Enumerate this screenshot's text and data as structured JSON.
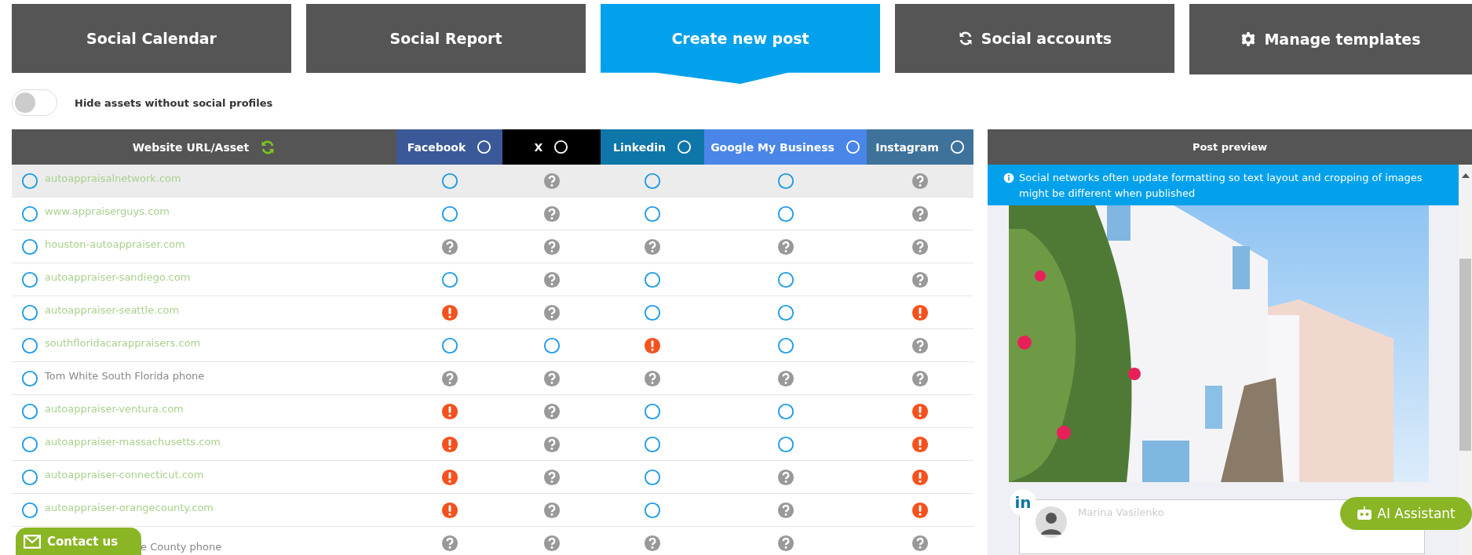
{
  "tabs": [
    {
      "label": "Social Calendar",
      "kind": "plain",
      "selected": false
    },
    {
      "label": "Social Report",
      "kind": "plain",
      "selected": false
    },
    {
      "label": "Create new post",
      "kind": "plain",
      "selected": true
    },
    {
      "label": "Social accounts",
      "kind": "refresh",
      "selected": false
    },
    {
      "label": "Manage templates",
      "kind": "gear",
      "selected": false
    }
  ],
  "filter_toggle": {
    "label": "Hide assets without social profiles",
    "on": false
  },
  "table": {
    "asset_column": "Website URL/Asset",
    "networks": [
      {
        "label": "Facebook",
        "color": "#3b5998"
      },
      {
        "label": "X",
        "color": "#000000"
      },
      {
        "label": "Linkedin",
        "color": "#0e76a8"
      },
      {
        "label": "Google My Business",
        "color": "#4a86e8"
      },
      {
        "label": "Instagram",
        "color": "#3f729b"
      }
    ],
    "rows": [
      {
        "asset": "autoappraisalnetwork.com",
        "kind": "url",
        "selected": true,
        "cells": [
          {
            "kind": "open"
          },
          {
            "kind": "unknown"
          },
          {
            "kind": "open"
          },
          {
            "kind": "open"
          },
          {
            "kind": "unknown"
          }
        ]
      },
      {
        "asset": "www.appraiserguys.com",
        "kind": "url",
        "selected": false,
        "cells": [
          {
            "kind": "open"
          },
          {
            "kind": "unknown"
          },
          {
            "kind": "open"
          },
          {
            "kind": "open"
          },
          {
            "kind": "unknown"
          }
        ]
      },
      {
        "asset": "houston-autoappraiser.com",
        "kind": "url",
        "selected": false,
        "cells": [
          {
            "kind": "unknown"
          },
          {
            "kind": "unknown"
          },
          {
            "kind": "unknown"
          },
          {
            "kind": "unknown"
          },
          {
            "kind": "unknown"
          }
        ]
      },
      {
        "asset": "autoappraiser-sandiego.com",
        "kind": "url",
        "selected": false,
        "cells": [
          {
            "kind": "open"
          },
          {
            "kind": "unknown"
          },
          {
            "kind": "open"
          },
          {
            "kind": "open"
          },
          {
            "kind": "unknown"
          }
        ]
      },
      {
        "asset": "autoappraiser-seattle.com",
        "kind": "url",
        "selected": false,
        "cells": [
          {
            "kind": "error"
          },
          {
            "kind": "unknown"
          },
          {
            "kind": "open"
          },
          {
            "kind": "open"
          },
          {
            "kind": "error"
          }
        ]
      },
      {
        "asset": "southfloridacarappraisers.com",
        "kind": "url",
        "selected": false,
        "cells": [
          {
            "kind": "open"
          },
          {
            "kind": "open"
          },
          {
            "kind": "error"
          },
          {
            "kind": "open"
          },
          {
            "kind": "unknown"
          }
        ]
      },
      {
        "asset": "Tom White South Florida phone",
        "kind": "phone",
        "selected": false,
        "cells": [
          {
            "kind": "unknown"
          },
          {
            "kind": "unknown"
          },
          {
            "kind": "unknown"
          },
          {
            "kind": "unknown"
          },
          {
            "kind": "unknown"
          }
        ]
      },
      {
        "asset": "autoappraiser-ventura.com",
        "kind": "url",
        "selected": false,
        "cells": [
          {
            "kind": "error"
          },
          {
            "kind": "unknown"
          },
          {
            "kind": "open"
          },
          {
            "kind": "open"
          },
          {
            "kind": "error"
          }
        ]
      },
      {
        "asset": "autoappraiser-massachusetts.com",
        "kind": "url",
        "selected": false,
        "cells": [
          {
            "kind": "error"
          },
          {
            "kind": "unknown"
          },
          {
            "kind": "open"
          },
          {
            "kind": "open"
          },
          {
            "kind": "error"
          }
        ]
      },
      {
        "asset": "autoappraiser-connecticut.com",
        "kind": "url",
        "selected": false,
        "cells": [
          {
            "kind": "error"
          },
          {
            "kind": "unknown"
          },
          {
            "kind": "open"
          },
          {
            "kind": "unknown"
          },
          {
            "kind": "error"
          }
        ]
      },
      {
        "asset": "autoappraiser-orangecounty.com",
        "kind": "url",
        "selected": false,
        "cells": [
          {
            "kind": "error"
          },
          {
            "kind": "unknown"
          },
          {
            "kind": "open"
          },
          {
            "kind": "unknown"
          },
          {
            "kind": "error"
          }
        ]
      },
      {
        "asset": "e County phone",
        "kind": "phone",
        "selected": false,
        "cells": [
          {
            "kind": "unknown"
          },
          {
            "kind": "unknown"
          },
          {
            "kind": "unknown"
          },
          {
            "kind": "unknown"
          },
          {
            "kind": "unknown"
          }
        ]
      }
    ]
  },
  "preview": {
    "title": "Post preview",
    "notice": "Social networks often update formatting so text layout and cropping of images might be different when published",
    "network_badge": "in",
    "author": "Marina Vasilenko"
  },
  "contact_button": "Contact us",
  "assistant_button": "AI Assistant"
}
